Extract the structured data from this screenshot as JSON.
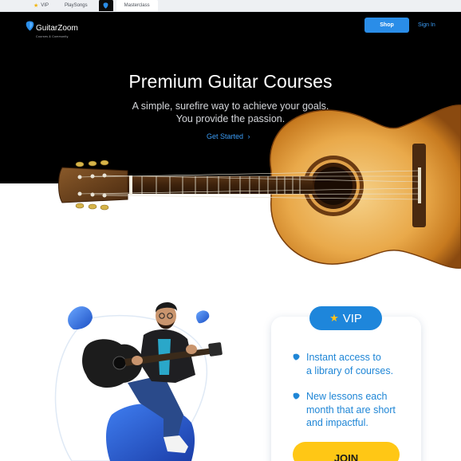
{
  "tabs": [
    {
      "label": "VIP",
      "icon": "star-icon"
    },
    {
      "label": "PlaySongs"
    },
    {
      "label": "",
      "icon": "guitarzoom-logo-icon"
    },
    {
      "label": "Masterclass"
    }
  ],
  "header": {
    "brand_name": "GuitarZoom",
    "brand_tagline": "Courses & Community",
    "shop_label": "Shop",
    "signin_label": "Sign In"
  },
  "hero": {
    "title": "Premium Guitar Courses",
    "subtitle": "A simple, surefire way to achieve your goals.\nYou provide the passion.",
    "cta_label": "Get Started",
    "cta_icon": "chevron-right-icon"
  },
  "vip": {
    "badge_label": "VIP",
    "badge_icon": "star-icon",
    "features": [
      "Instant access to\na library of courses.",
      "New lessons each\nmonth that are short\nand impactful."
    ],
    "join_label": "JOIN"
  },
  "colors": {
    "accent_blue": "#2a8de8",
    "link_blue": "#3b9cf5",
    "feature_blue": "#1f86d6",
    "join_yellow": "#ffc715",
    "hero_bg": "#000000"
  }
}
